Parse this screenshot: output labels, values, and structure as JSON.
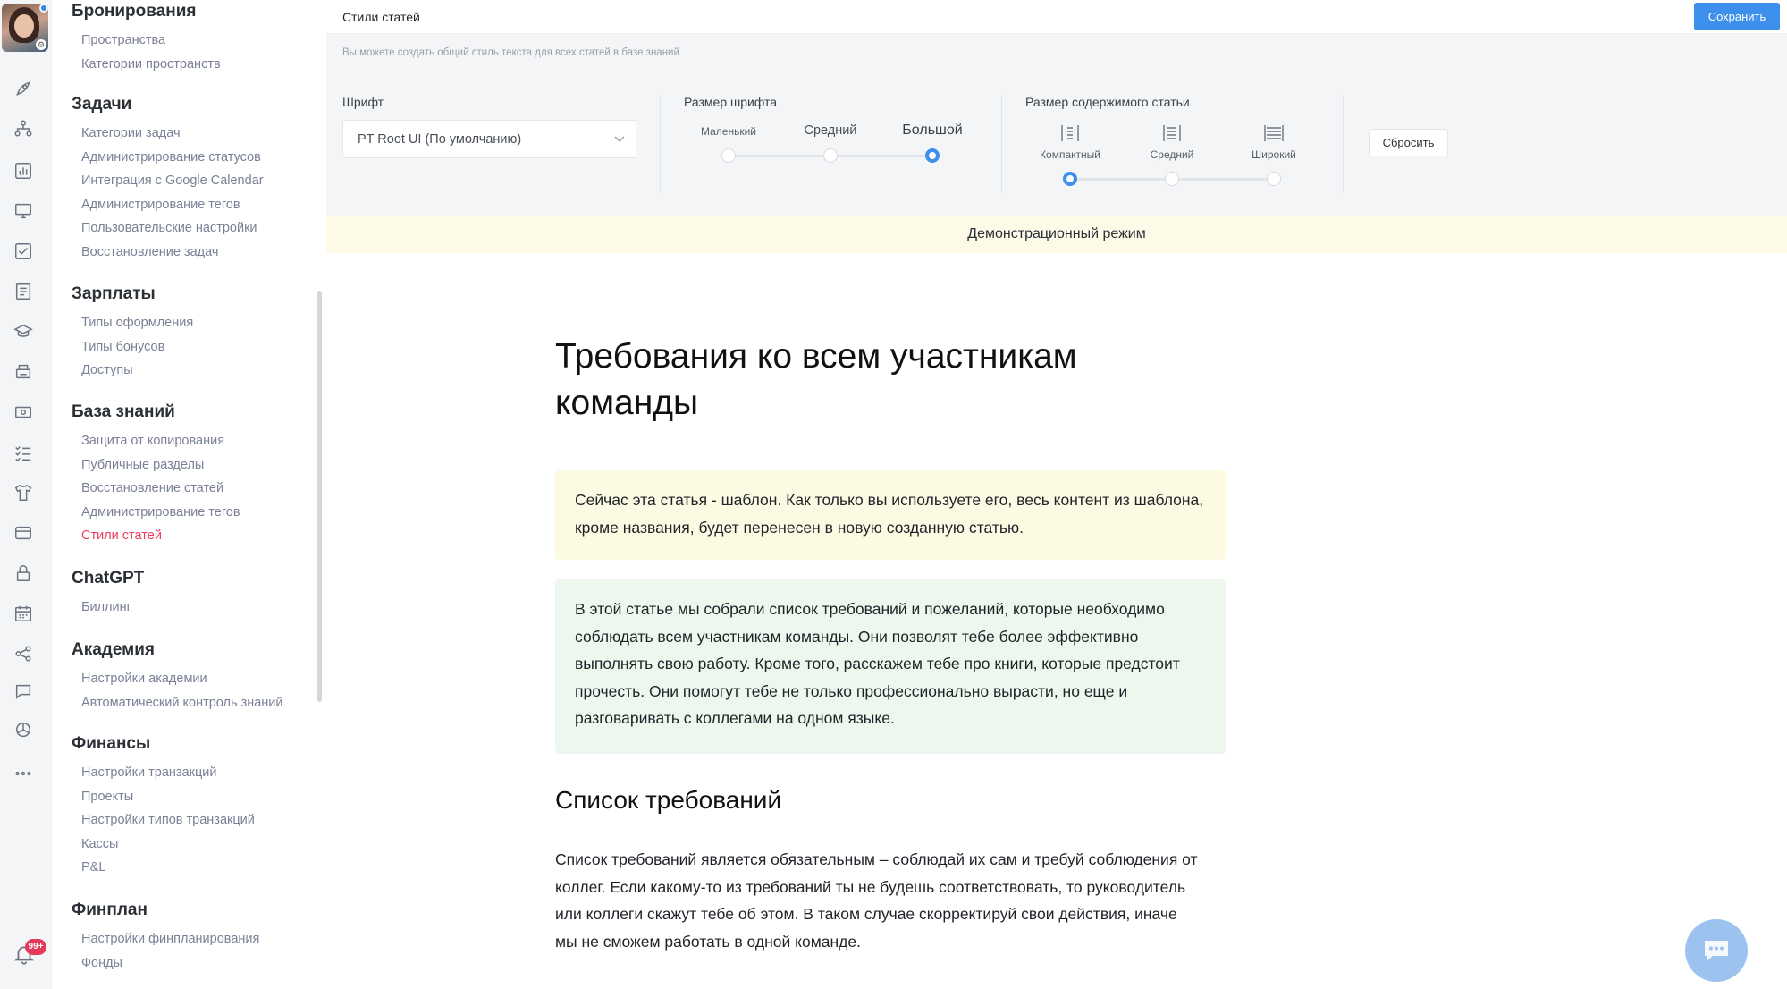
{
  "rail": {
    "icons": [
      "rocket-icon",
      "structure-icon",
      "chart-icon",
      "monitor-icon",
      "checkbox-icon",
      "document-icon",
      "graduation-icon",
      "printer-icon",
      "money-icon",
      "checklist-icon",
      "tshirt-icon",
      "card-icon",
      "lock-icon",
      "calendar-icon",
      "share-icon",
      "chat-icon",
      "openai-icon",
      "more-icon"
    ],
    "notifications_badge": "99+"
  },
  "menu": {
    "sections": [
      {
        "title": "Бронирования",
        "items": [
          "Пространства",
          "Категории пространств"
        ]
      },
      {
        "title": "Задачи",
        "items": [
          "Категории задач",
          "Администрирование статусов",
          "Интеграция с Google Calendar",
          "Администрирование тегов",
          "Пользовательские настройки",
          "Восстановление задач"
        ]
      },
      {
        "title": "Зарплаты",
        "items": [
          "Типы оформления",
          "Типы бонусов",
          "Доступы"
        ]
      },
      {
        "title": "База знаний",
        "items": [
          "Защита от копирования",
          "Публичные разделы",
          "Восстановление статей",
          "Администрирование тегов",
          "Стили статей"
        ]
      },
      {
        "title": "ChatGPT",
        "items": [
          "Биллинг"
        ]
      },
      {
        "title": "Академия",
        "items": [
          "Настройки академии",
          "Автоматический контроль знаний"
        ]
      },
      {
        "title": "Финансы",
        "items": [
          "Настройки транзакций",
          "Проекты",
          "Настройки типов транзакций",
          "Кассы",
          "P&L"
        ]
      },
      {
        "title": "Финплан",
        "items": [
          "Настройки финпланирования",
          "Фонды"
        ]
      }
    ],
    "active_item": "Стили статей"
  },
  "header": {
    "title": "Стили статей",
    "save_label": "Сохранить"
  },
  "settings": {
    "hint": "Вы можете создать общий стиль текста для всех статей в базе знаний",
    "font_label": "Шрифт",
    "font_value": "PT Root UI (По умолчанию)",
    "font_size_label": "Размер шрифта",
    "font_size_options": [
      "Маленький",
      "Средний",
      "Большой"
    ],
    "font_size_selected": "Большой",
    "content_width_label": "Размер содержимого статьи",
    "content_width_options": [
      "Компактный",
      "Средний",
      "Широкий"
    ],
    "content_width_selected": "Компактный",
    "reset_label": "Сбросить"
  },
  "demo_banner": "Демонстрационный режим",
  "article": {
    "title": "Требования ко всем участникам команды",
    "callout_yellow": "Сейчас эта статья - шаблон. Как только вы используете его, весь контент из шаблона, кроме названия, будет перенесен в новую созданную статью.",
    "callout_green": "В этой статье мы собрали список требований и пожеланий, которые необходимо соблюдать всем участникам команды. Они позволят тебе более эффективно выполнять свою работу. Кроме того, расскажем тебе про книги, которые предстоит прочесть. Они помогут тебе не только профессионально вырасти, но еще и разговаривать с коллегами на одном языке.",
    "heading": "Список требований",
    "paragraph": "Список требований является обязательным – соблюдай их сам и требуй соблюдения от коллег. Если какому-то из требований ты не будешь соответствовать, то руководитель или коллеги скажут тебе об этом. В таком случае скорректируй свои действия, иначе мы не сможем работать в одной команде."
  },
  "colors": {
    "accent": "#3c8fea",
    "active_link": "#ec3f63",
    "badge": "#e5395a"
  }
}
